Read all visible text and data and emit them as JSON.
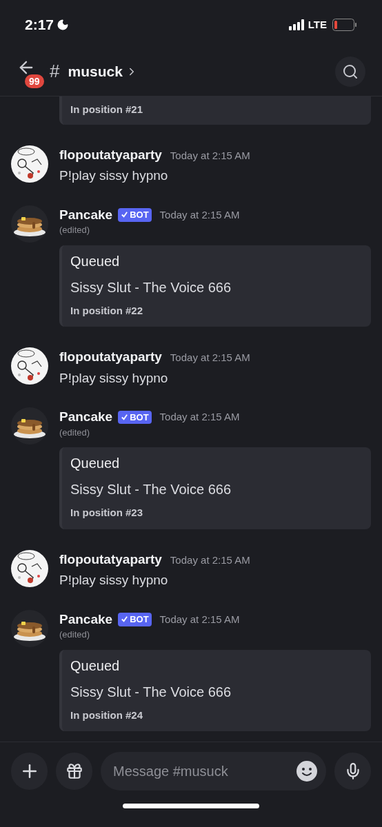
{
  "status_bar": {
    "time": "2:17",
    "network": "LTE"
  },
  "header": {
    "unread_badge": "99",
    "channel_hash": "#",
    "channel": "musuck"
  },
  "partial_embed": {
    "footer": "In position #21"
  },
  "messages": [
    {
      "kind": "user",
      "author": "flopoutatyaparty",
      "time": "Today at 2:15 AM",
      "text": "P!play sissy hypno"
    },
    {
      "kind": "bot",
      "author": "Pancake",
      "badge": "BOT",
      "time": "Today at 2:15 AM",
      "edited": "(edited)",
      "embed": {
        "title": "Queued",
        "description": "Sissy Slut - The Voice 666",
        "footer": "In position #22"
      }
    },
    {
      "kind": "user",
      "author": "flopoutatyaparty",
      "time": "Today at 2:15 AM",
      "text": "P!play sissy hypno"
    },
    {
      "kind": "bot",
      "author": "Pancake",
      "badge": "BOT",
      "time": "Today at 2:15 AM",
      "edited": "(edited)",
      "embed": {
        "title": "Queued",
        "description": "Sissy Slut - The Voice 666",
        "footer": "In position #23"
      }
    },
    {
      "kind": "user",
      "author": "flopoutatyaparty",
      "time": "Today at 2:15 AM",
      "text": "P!play sissy hypno"
    },
    {
      "kind": "bot",
      "author": "Pancake",
      "badge": "BOT",
      "time": "Today at 2:15 AM",
      "edited": "(edited)",
      "embed": {
        "title": "Queued",
        "description": "Sissy Slut - The Voice 666",
        "footer": "In position #24"
      }
    }
  ],
  "composer": {
    "placeholder": "Message #musuck"
  }
}
